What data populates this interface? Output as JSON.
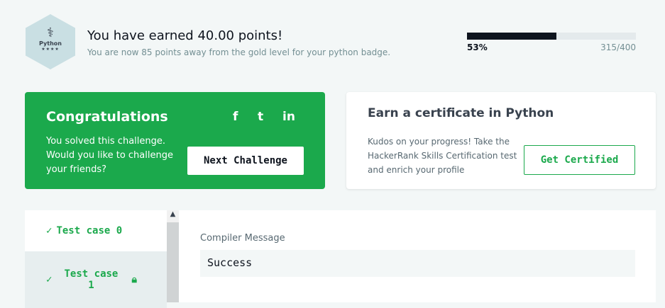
{
  "badge": {
    "language": "Python",
    "stars": "★★★★",
    "icon": "python-logo"
  },
  "header": {
    "title": "You have earned 40.00 points!",
    "subtitle": "You are now 85 points away from the gold level for your python badge.",
    "progress_percent": 53,
    "progress_label": "53%",
    "progress_count": "315/400"
  },
  "congrats": {
    "title": "Congratulations",
    "message": "You solved this challenge. Would you like to challenge your friends?",
    "next_label": "Next Challenge",
    "social": [
      "f",
      "t",
      "in"
    ]
  },
  "certificate": {
    "title": "Earn a certificate in Python",
    "message": "Kudos on your progress! Take the HackerRank Skills Certification test and enrich your profile",
    "button_label": "Get Certified"
  },
  "tests": [
    {
      "label": "Test case 0"
    },
    {
      "label": "Test case 1"
    }
  ],
  "compiler": {
    "label": "Compiler Message",
    "output": "Success"
  },
  "colors": {
    "green": "#1ba94c",
    "dark": "#0e141e"
  }
}
